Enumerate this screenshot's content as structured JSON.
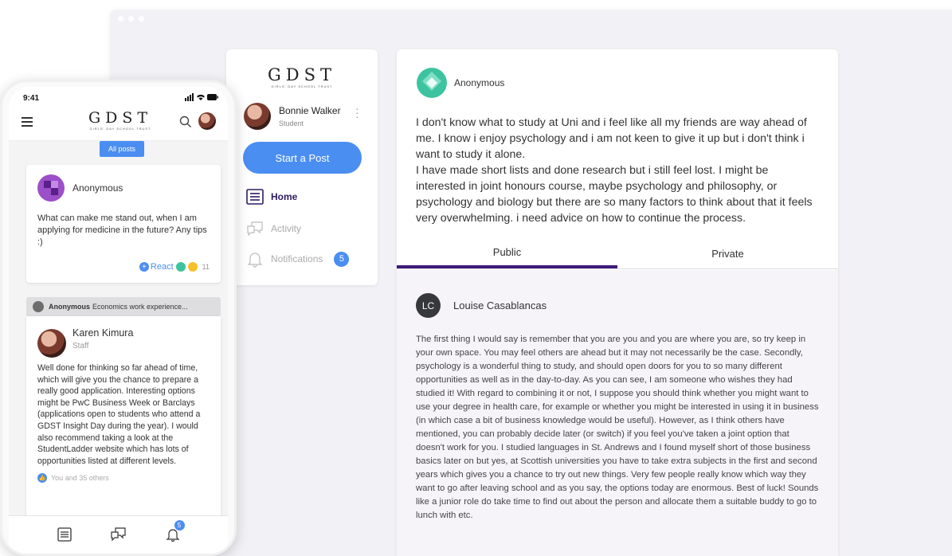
{
  "brand": {
    "logo": "GDST",
    "tagline": "GIRLS' DAY SCHOOL TRUST"
  },
  "sidebar": {
    "user_name": "Bonnie Walker",
    "user_role": "Student",
    "start_post": "Start a Post",
    "nav": [
      {
        "label": "Home",
        "icon": "home-icon"
      },
      {
        "label": "Activity",
        "icon": "chat-bubbles-icon"
      },
      {
        "label": "Notifications",
        "icon": "bell-icon",
        "badge": "5"
      }
    ]
  },
  "post": {
    "author": "Anonymous",
    "body": "I don't know what to study at Uni and i feel like all my friends are way ahead of me. I know i enjoy psychology and i am not keen to give it up but i don't think i want to study it alone.\nI have made short lists and done research but i still feel lost. I might be interested in joint honours course, maybe psychology and philosophy, or psychology and biology but there are so many factors to think about that it feels very overwhelming. i need advice on how to continue the process.",
    "tabs": [
      "Public",
      "Private"
    ]
  },
  "reply": {
    "initials": "LC",
    "author": "Louise Casablancas",
    "body": "The first thing I would say is remember that you are you and you are where you are, so try keep in your own space. You may feel others are ahead but it may not necessarily be the case. Secondly, psychology is a wonderful thing to study, and should open doors for you to so many different opportunities as well as in the day-to-day. As you can see, I am someone who wishes they had studied it! With regard to combining it or not, I suppose you should think whether you might want to use your degree in health care, for example or whether you might be interested in using it in business (in which case a bit of business knowledge would be useful). However, as I think others have mentioned, you can probably decide later (or switch) if you feel you've taken a joint option that doesn't work for you. I studied languages in St. Andrews and I found myself short of those business basics later on but yes, at Scottish universities you have to take extra subjects in the first and second years which gives you a chance to try out new things. Very few people really know which way they want to go after leaving school and as you say, the options today are enormous. Best of luck! Sounds like a junior role do take time to find out about the person and allocate them a suitable buddy to go to lunch with etc."
  },
  "phone": {
    "time": "9:41",
    "all_posts": "All posts",
    "card1": {
      "author": "Anonymous",
      "text": "What can make me stand out, when I am applying for medicine in the future? Any tips :)",
      "react": "React",
      "react_count": "11"
    },
    "thread": {
      "author": "Anonymous",
      "title": "Economics work experience..."
    },
    "card2": {
      "author": "Karen Kimura",
      "role": "Staff",
      "text": "Well done for thinking so far ahead of time, which will give you the chance to prepare a really good application. Interesting options might be PwC Business Week or Barclays (applications open to students who attend a GDST Insight Day during the year). I would also recommend taking a look at the StudentLadder website which has lots of opportunities listed at different levels.",
      "likes": "You and 35 others"
    },
    "tabbar_badge": "5"
  },
  "colors": {
    "accent": "#4b8ef1",
    "brand_purple": "#3e1a7a"
  }
}
